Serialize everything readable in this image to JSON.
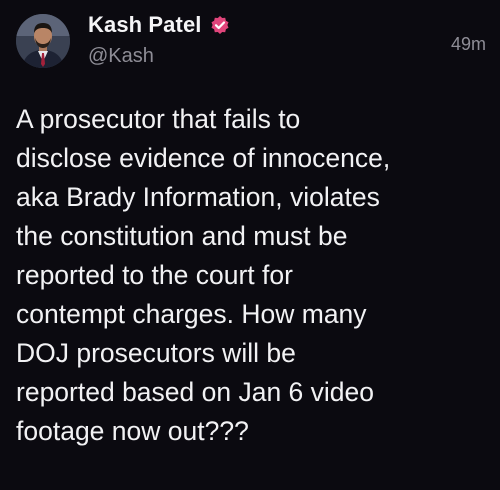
{
  "author": {
    "display_name": "Kash Patel",
    "handle": "@Kash",
    "avatar_icon": "profile-photo",
    "verified_icon": "verified-badge-icon",
    "verified_color": "#e0457b"
  },
  "post": {
    "timestamp": "49m",
    "text": "A prosecutor that fails to\ndisclose evidence of innocence,\naka Brady Information, violates\nthe constitution and must be\nreported to the court for\ncontempt charges. How many\nDOJ prosecutors will be\nreported based on Jan 6 video\nfootage now out???"
  },
  "colors": {
    "background": "#0b0a10",
    "text_primary": "#f2f2f4",
    "text_secondary": "#8e8d96"
  }
}
